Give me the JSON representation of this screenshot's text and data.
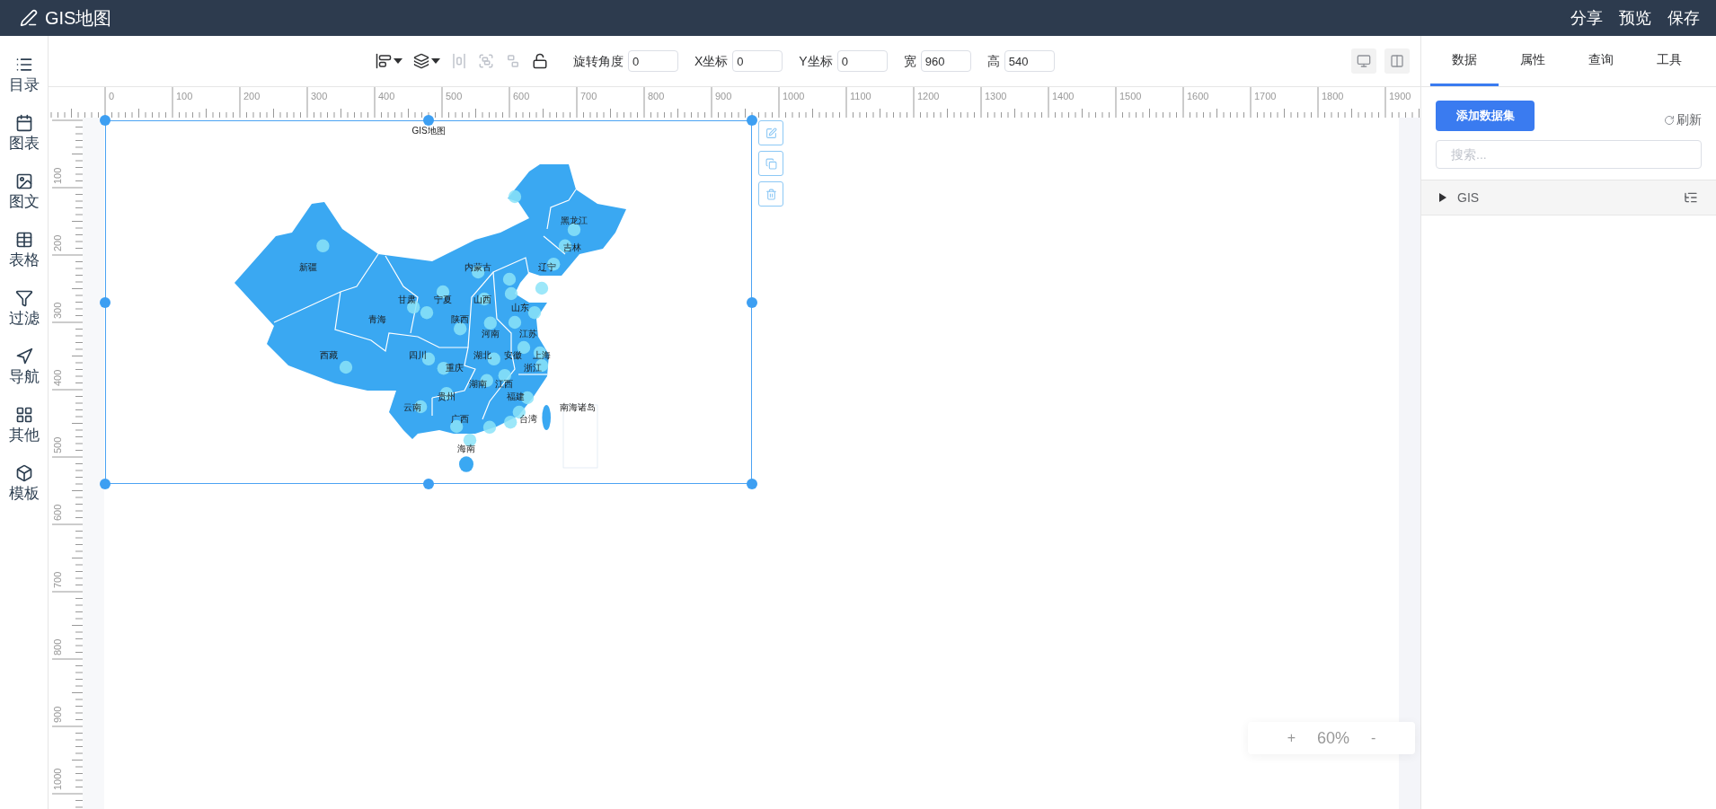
{
  "header": {
    "title": "GIS地图",
    "actions": [
      "分享",
      "预览",
      "保存"
    ]
  },
  "sidebar": {
    "items": [
      "目录",
      "图表",
      "图文",
      "表格",
      "过滤",
      "导航",
      "其他",
      "模板"
    ]
  },
  "toolbar": {
    "tools": [
      {
        "kind": "align",
        "caret": true,
        "disabled": false
      },
      {
        "kind": "layer",
        "caret": true,
        "disabled": false
      },
      {
        "kind": "distribute",
        "caret": false,
        "disabled": true
      },
      {
        "kind": "group",
        "caret": false,
        "disabled": true
      },
      {
        "kind": "ungroup",
        "caret": false,
        "disabled": true
      },
      {
        "kind": "lock",
        "caret": false,
        "disabled": false
      }
    ],
    "fields": [
      {
        "label": "旋转角度",
        "value": "0"
      },
      {
        "label": "X坐标",
        "value": "0"
      },
      {
        "label": "Y坐标",
        "value": "0"
      },
      {
        "label": "宽",
        "value": "960"
      },
      {
        "label": "高",
        "value": "540"
      }
    ]
  },
  "rulers": {
    "horizontal": [
      "0",
      "100",
      "200",
      "300",
      "400",
      "500",
      "600",
      "700",
      "800",
      "900",
      "1000",
      "1100",
      "1200",
      "1300",
      "1400",
      "1500",
      "1600",
      "1700",
      "1800",
      "1900"
    ],
    "vertical": [
      "100",
      "200",
      "300",
      "400",
      "500",
      "600",
      "700",
      "800",
      "900",
      "1000"
    ]
  },
  "canvas": {
    "component": {
      "title": "GIS地图",
      "selected": true,
      "regions": [
        "黑龙江",
        "吉林",
        "新疆",
        "内蒙古",
        "辽宁",
        "甘肃",
        "宁夏",
        "山西",
        "山东",
        "青海",
        "陕西",
        "河南",
        "江苏",
        "西藏",
        "四川",
        "湖北",
        "安徽",
        "上海",
        "重庆",
        "浙江",
        "湖南",
        "江西",
        "贵州",
        "福建",
        "云南",
        "南海诸岛",
        "广西",
        "台湾",
        "海南"
      ]
    },
    "zoom": {
      "zoom_in": "+",
      "level": "60%",
      "zoom_out": "-"
    }
  },
  "panel": {
    "tabs": [
      {
        "label": "数据",
        "selected": true
      },
      {
        "label": "属性",
        "selected": false
      },
      {
        "label": "查询",
        "selected": false
      },
      {
        "label": "工具",
        "selected": false
      }
    ],
    "add_button": "添加数据集",
    "refresh": "刷新",
    "search": {
      "placeholder": "搜索..."
    },
    "datasets": [
      {
        "name": "GIS",
        "expanded": false
      }
    ]
  }
}
